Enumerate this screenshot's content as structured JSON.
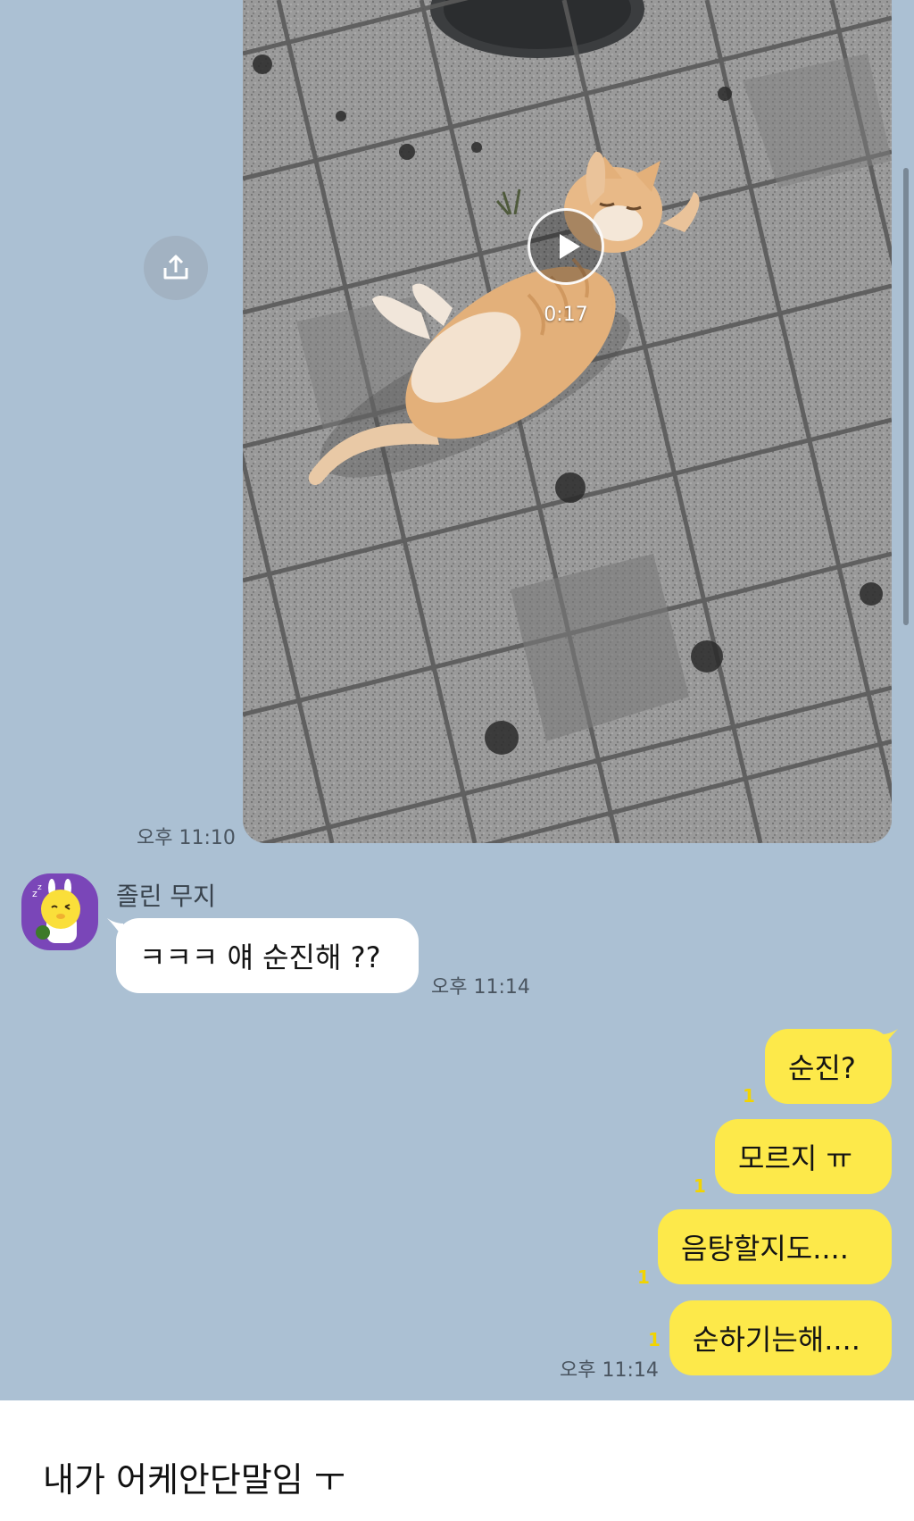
{
  "video_message": {
    "duration": "0:17",
    "time": "오후 11:10"
  },
  "incoming": {
    "sender": "졸린 무지",
    "message": "ㅋㅋㅋ 얘 순진해 ??",
    "time": "오후 11:14"
  },
  "outgoing": {
    "messages": [
      {
        "text": "순진?",
        "unread": "1"
      },
      {
        "text": "모르지 ㅠ",
        "unread": "1"
      },
      {
        "text": "음탕할지도....",
        "unread": "1"
      },
      {
        "text": "순하기는해....",
        "unread": "1"
      }
    ],
    "time": "오후 11:14"
  },
  "caption": "내가 어케안단말임 ㅜ",
  "colors": {
    "chat_background": "#abc0d3",
    "outgoing_bubble": "#fde94a",
    "incoming_bubble": "#ffffff",
    "unread_count": "#f2d400"
  },
  "icons": {
    "share": "share-upload-icon",
    "play": "play-icon",
    "avatar": "muzi-character-icon"
  }
}
